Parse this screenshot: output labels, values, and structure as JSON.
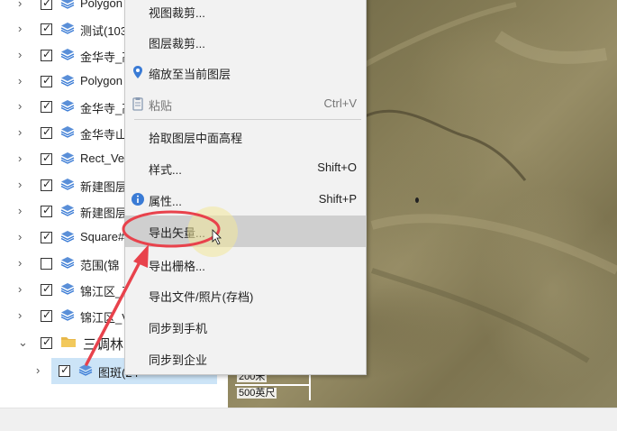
{
  "tree": {
    "rows": [
      {
        "label": "Polygon",
        "checked": true
      },
      {
        "label": "测试(103",
        "checked": true
      },
      {
        "label": "金华寺_高",
        "checked": true
      },
      {
        "label": "Polygon",
        "checked": true
      },
      {
        "label": "金华寺_高",
        "checked": true
      },
      {
        "label": "金华寺山",
        "checked": true
      },
      {
        "label": "Rect_Ve",
        "checked": true
      },
      {
        "label": "新建图层",
        "checked": true
      },
      {
        "label": "新建图层",
        "checked": true
      },
      {
        "label": "Square#",
        "checked": true
      },
      {
        "label": "范围(锦",
        "checked": false
      },
      {
        "label": "锦江区_高",
        "checked": true
      },
      {
        "label": "锦江区_V",
        "checked": true
      }
    ],
    "folder": {
      "label": "三调林",
      "checked": true
    },
    "selected": {
      "label": "图斑(24",
      "checked": true
    }
  },
  "menu": {
    "items": [
      {
        "label": "视图裁剪...",
        "shortcut": ""
      },
      {
        "label": "图层裁剪...",
        "shortcut": ""
      },
      {
        "label": "缩放至当前图层",
        "shortcut": "",
        "icon": "location-pin-icon"
      },
      {
        "label": "粘贴",
        "shortcut": "Ctrl+V",
        "icon": "paste-icon",
        "disabled": true
      },
      {
        "label": "拾取图层中面高程",
        "shortcut": ""
      },
      {
        "label": "样式...",
        "shortcut": "Shift+O"
      },
      {
        "label": "属性...",
        "shortcut": "Shift+P",
        "icon": "info-icon"
      },
      {
        "label": "导出矢量...",
        "shortcut": "",
        "highlighted": true
      },
      {
        "label": "导出栅格...",
        "shortcut": ""
      },
      {
        "label": "导出文件/照片(存档)",
        "shortcut": ""
      },
      {
        "label": "同步到手机",
        "shortcut": ""
      },
      {
        "label": "同步到企业",
        "shortcut": ""
      }
    ]
  },
  "map": {
    "scale_top": "200米",
    "scale_bottom": "500英尺"
  },
  "colors": {
    "annotation_red": "#e8424c",
    "selection_blue": "#cce4f7",
    "menu_hover": "#cfcfcf",
    "layer_icon_blue": "#3a7bd5"
  }
}
